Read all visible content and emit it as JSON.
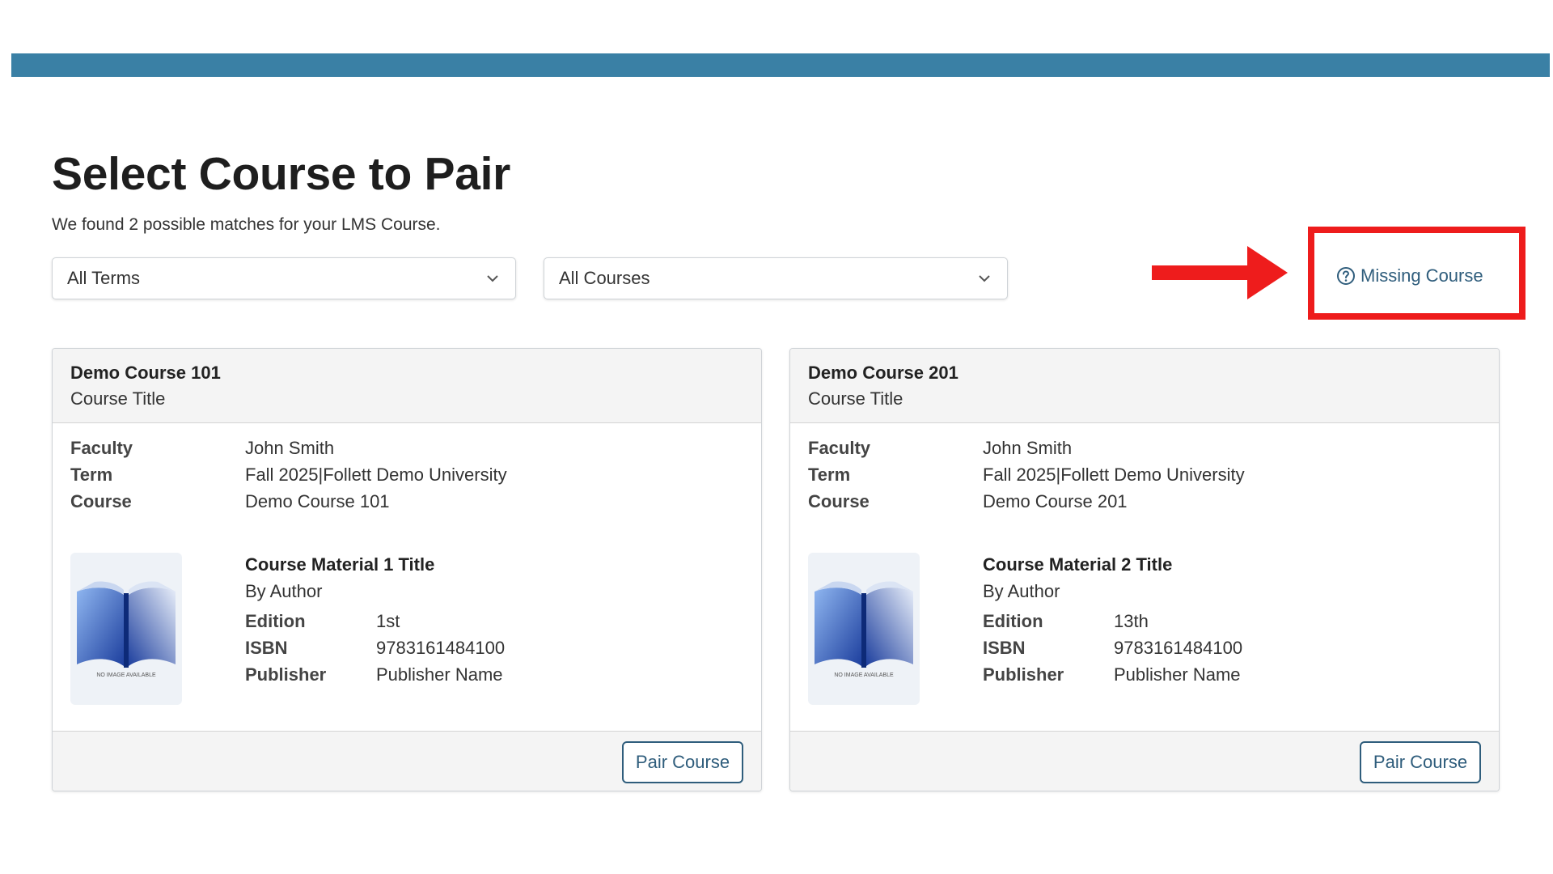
{
  "colors": {
    "top_bar": "#3a80a5",
    "annotation_red": "#ee1c1c",
    "link_blue": "#2f5d7c"
  },
  "header": {
    "title": "Select Course to Pair",
    "subtitle": "We found 2 possible matches for your LMS Course."
  },
  "filters": {
    "terms": "All Terms",
    "courses": "All Courses"
  },
  "missing_course": {
    "label": "Missing Course",
    "icon": "question-circle-icon"
  },
  "cards": [
    {
      "code": "Demo Course 101",
      "title": "Course Title",
      "faculty_label": "Faculty",
      "faculty": "John Smith",
      "term_label": "Term",
      "term": "Fall 2025|Follett Demo University",
      "course_label": "Course",
      "course": "Demo Course 101",
      "material": {
        "title": "Course Material 1 Title",
        "author": "By Author",
        "edition_label": "Edition",
        "edition": "1st",
        "isbn_label": "ISBN",
        "isbn": "9783161484100",
        "publisher_label": "Publisher",
        "publisher": "Publisher Name",
        "image_text": "NO IMAGE AVAILABLE"
      },
      "button": "Pair Course"
    },
    {
      "code": "Demo Course 201",
      "title": "Course Title",
      "faculty_label": "Faculty",
      "faculty": "John Smith",
      "term_label": "Term",
      "term": "Fall 2025|Follett Demo University",
      "course_label": "Course",
      "course": "Demo Course 201",
      "material": {
        "title": "Course Material 2 Title",
        "author": "By Author",
        "edition_label": "Edition",
        "edition": "13th",
        "isbn_label": "ISBN",
        "isbn": "9783161484100",
        "publisher_label": "Publisher",
        "publisher": "Publisher Name",
        "image_text": "NO IMAGE AVAILABLE"
      },
      "button": "Pair Course"
    }
  ]
}
